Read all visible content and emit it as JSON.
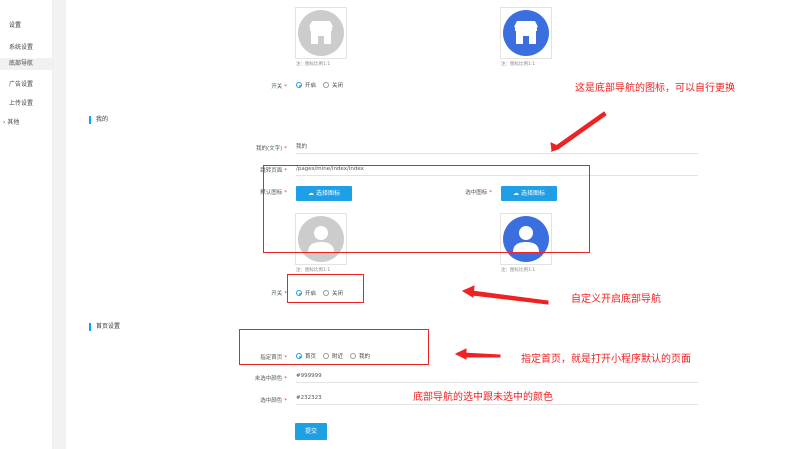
{
  "sidebar": {
    "title": "设置",
    "items": [
      {
        "label": "系统设置"
      },
      {
        "label": "底部导航"
      },
      {
        "label": "广告设置"
      },
      {
        "label": "上传设置"
      },
      {
        "label": "其他"
      }
    ]
  },
  "top_section": {
    "note_left": "注：图标比例1:1",
    "note_right": "注：图标比例1:1",
    "switch_label": "开关",
    "switch_on": "开启",
    "switch_off": "关闭",
    "switch_value": "开启"
  },
  "mine_section": {
    "title": "我的",
    "text_label": "我的(文字)",
    "text_value": "我的",
    "page_label": "跳转页面",
    "page_value": "/pages/mine/index/index",
    "default_icon_label": "默认图标",
    "selected_icon_label": "选中图标",
    "choose_icon_btn": "选择图标",
    "note_left": "注：图标比例1:1",
    "note_right": "注：图标比例1:1",
    "switch_label": "开关",
    "switch_on": "开启",
    "switch_off": "关闭",
    "switch_value": "开启"
  },
  "home_section": {
    "title": "首页设置",
    "home_label": "指定首页",
    "options": [
      "首页",
      "附近",
      "我的"
    ],
    "selected": "首页",
    "unselected_color_label": "未选中颜色",
    "unselected_color_value": "#999999",
    "selected_color_label": "选中颜色",
    "selected_color_value": "#232323",
    "submit_label": "提交"
  },
  "annotations": {
    "icon_note": "这是底部导航的图标，可以自行更换",
    "custom_note": "自定义开启底部导航",
    "home_note": "指定首页，就是打开小程序默认的页面",
    "color_note": "底部导航的选中跟未选中的颜色"
  },
  "colors": {
    "accent": "#1e9fe6",
    "annotation_red": "#e22222",
    "icon_gray": "#cccccc",
    "icon_blue": "#3b6fe0"
  },
  "icons": [
    "store-icon",
    "user-icon",
    "cloud-upload-icon",
    "chevron-right-icon"
  ]
}
